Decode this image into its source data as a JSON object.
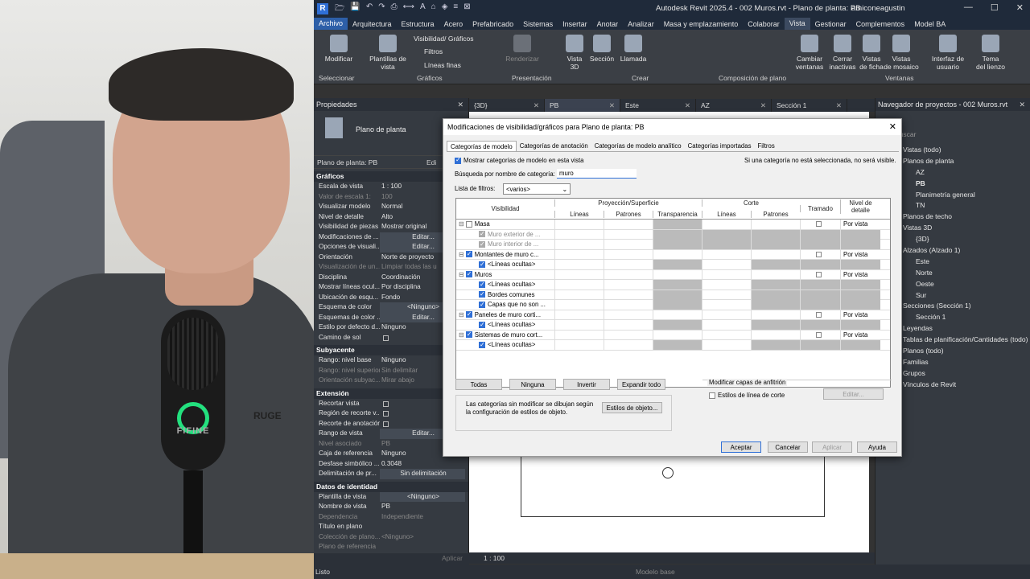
{
  "app": {
    "title": "Autodesk Revit 2025.4 - 002 Muros.rvt - Plano de planta: PB",
    "user": "amiconeagustin",
    "logo_letter": "R"
  },
  "ribbon_tabs": [
    "Archivo",
    "Arquitectura",
    "Estructura",
    "Acero",
    "Prefabricado",
    "Sistemas",
    "Insertar",
    "Anotar",
    "Analizar",
    "Masa y emplazamiento",
    "Colaborar",
    "Vista",
    "Gestionar",
    "Complementos",
    "Model BA"
  ],
  "ribbon": {
    "modify": "Modificar",
    "select": "Seleccionar",
    "plantillas": "Plantillas de\nvista",
    "vis_graf": "Visibilidad/ Gráficos",
    "filtros": "Filtros",
    "lineas_finas": "Líneas finas",
    "graficos": "Gráficos",
    "renderizar": "Renderizar",
    "presentacion": "Presentación",
    "vista3d": "Vista\n3D",
    "seccion": "Sección",
    "llamada": "Llamada",
    "crear": "Crear",
    "comp_plano": "Composición de plano",
    "cambiar": "Cambiar\nventanas",
    "cerrar": "Cerrar\ninactivas",
    "ficha": "Vistas\nde ficha",
    "mosaico": "Vistas\nde mosaico",
    "interfaz": "Interfaz de\nusuario",
    "tema": "Tema\ndel lienzo",
    "ventanas": "Ventanas"
  },
  "properties": {
    "header": "Propiedades",
    "type_name": "Plano de planta",
    "type_selector": "Plano de planta: PB",
    "edit_type": "Edi",
    "sections": [
      {
        "title": "Gráficos",
        "rows": [
          {
            "k": "Escala de vista",
            "v": "1 : 100"
          },
          {
            "k": "Valor de escala  1:",
            "v": "100",
            "dis": true
          },
          {
            "k": "Visualizar modelo",
            "v": "Normal"
          },
          {
            "k": "Nivel de detalle",
            "v": "Alto"
          },
          {
            "k": "Visibilidad de piezas",
            "v": "Mostrar original"
          },
          {
            "k": "Modificaciones de ...",
            "v": "Editar...",
            "btn": true
          },
          {
            "k": "Opciones de visuali...",
            "v": "Editar...",
            "btn": true
          },
          {
            "k": "Orientación",
            "v": "Norte de proyecto"
          },
          {
            "k": "Visualización de un...",
            "v": "Limpiar todas las u",
            "dis": true
          },
          {
            "k": "Disciplina",
            "v": "Coordinación"
          },
          {
            "k": "Mostrar líneas ocul...",
            "v": "Por disciplina"
          },
          {
            "k": "Ubicación de esqu...",
            "v": "Fondo"
          },
          {
            "k": "Esquema de color",
            "v": "<Ninguno>",
            "btn": true
          },
          {
            "k": "Esquemas de color ...",
            "v": "Editar...",
            "btn": true
          },
          {
            "k": "Estilo por defecto d...",
            "v": "Ninguno"
          },
          {
            "k": "Camino de sol",
            "v": "",
            "cb": true
          }
        ]
      },
      {
        "title": "Subyacente",
        "rows": [
          {
            "k": "Rango: nivel base",
            "v": "Ninguno"
          },
          {
            "k": "Rango: nivel superior",
            "v": "Sin delimitar",
            "dis": true
          },
          {
            "k": "Orientación subyac...",
            "v": "Mirar abajo",
            "dis": true
          }
        ]
      },
      {
        "title": "Extensión",
        "rows": [
          {
            "k": "Recortar vista",
            "v": "",
            "cb": true
          },
          {
            "k": "Región de recorte v...",
            "v": "",
            "cb": true
          },
          {
            "k": "Recorte de anotación",
            "v": "",
            "cb": true
          },
          {
            "k": "Rango de vista",
            "v": "Editar...",
            "btn": true
          },
          {
            "k": "Nivel asociado",
            "v": "PB",
            "dis": true
          },
          {
            "k": "Caja de referencia",
            "v": "Ninguno"
          },
          {
            "k": "Desfase simbólico ...",
            "v": "0.3048"
          },
          {
            "k": "Delimitación de pr...",
            "v": "Sin delimitación",
            "btn": true
          }
        ]
      },
      {
        "title": "Datos de identidad",
        "rows": [
          {
            "k": "Plantilla de vista",
            "v": "<Ninguno>",
            "btn": true
          },
          {
            "k": "Nombre de vista",
            "v": "PB"
          },
          {
            "k": "Dependencia",
            "v": "Independiente",
            "dis": true
          },
          {
            "k": "Título en plano",
            "v": ""
          },
          {
            "k": "Colección de plano...",
            "v": "<Ninguno>",
            "dis": true
          },
          {
            "k": "Plano de referencia",
            "v": "",
            "dis": true
          },
          {
            "k": "Detalle de referencia",
            "v": "",
            "dis": true
          }
        ]
      }
    ],
    "apply": "Aplicar"
  },
  "view_tabs": [
    "{3D}",
    "PB",
    "Este",
    "AZ",
    "Sección 1"
  ],
  "view_scale": "1 : 100",
  "status": {
    "ready": "Listo",
    "model": "Modelo base",
    "sel": ":0"
  },
  "browser": {
    "header": "Navegador de proyectos - 002 Muros.rvt",
    "search": "Buscar",
    "items": [
      {
        "t": "Vistas (todo)",
        "l": 1
      },
      {
        "t": "Planos de planta",
        "l": 1
      },
      {
        "t": "AZ",
        "l": 2
      },
      {
        "t": "PB",
        "l": 2,
        "b": true
      },
      {
        "t": "Planimetría general",
        "l": 2
      },
      {
        "t": "TN",
        "l": 2
      },
      {
        "t": "Planos de techo",
        "l": 1
      },
      {
        "t": "Vistas 3D",
        "l": 1
      },
      {
        "t": "{3D}",
        "l": 2
      },
      {
        "t": "Alzados (Alzado 1)",
        "l": 1
      },
      {
        "t": "Este",
        "l": 2
      },
      {
        "t": "Norte",
        "l": 2
      },
      {
        "t": "Oeste",
        "l": 2
      },
      {
        "t": "Sur",
        "l": 2
      },
      {
        "t": "Secciones (Sección 1)",
        "l": 1
      },
      {
        "t": "Sección 1",
        "l": 2
      },
      {
        "t": "Leyendas",
        "l": 1
      },
      {
        "t": "Tablas de planificación/Cantidades (todo)",
        "l": 1
      },
      {
        "t": "Planos (todo)",
        "l": 1
      },
      {
        "t": "Familias",
        "l": 1
      },
      {
        "t": "Grupos",
        "l": 1
      },
      {
        "t": "Vínculos de Revit",
        "l": 1
      }
    ]
  },
  "dialog": {
    "title": "Modificaciones de visibilidad/gráficos para Plano de planta: PB",
    "tabs": [
      "Categorías de modelo",
      "Categorías de anotación",
      "Categorías de modelo analítico",
      "Categorías importadas",
      "Filtros"
    ],
    "show_model_label": "Mostrar categorías de modelo en esta vista",
    "hint": "Si una categoría no está seleccionada, no será visible.",
    "search_label": "Búsqueda por nombre de categoría:",
    "search_value": "muro",
    "filter_label": "Lista de filtros:",
    "filter_value": "<varios>",
    "headers": {
      "visibilidad": "Visibilidad",
      "proy": "Proyección/Superficie",
      "corte": "Corte",
      "lineas": "Líneas",
      "patrones": "Patrones",
      "transparencia": "Transparencia",
      "lineas2": "Líneas",
      "patrones2": "Patrones",
      "tramado": "Tramado",
      "nivel": "Nivel de\ndetalle"
    },
    "rows": [
      {
        "name": "Masa",
        "lvl": 0,
        "chk": false,
        "exp": true,
        "tr": true,
        "pv": "Por vista"
      },
      {
        "name": "Muro exterior de ...",
        "lvl": 1,
        "chk": true,
        "dis": true
      },
      {
        "name": "Muro interior de ...",
        "lvl": 1,
        "chk": true,
        "dis": true
      },
      {
        "name": "Montantes de muro c...",
        "lvl": 0,
        "chk": true,
        "exp": true,
        "tr": true,
        "pv": "Por vista"
      },
      {
        "name": "<Líneas ocultas>",
        "lvl": 1,
        "chk": true
      },
      {
        "name": "Muros",
        "lvl": 0,
        "chk": true,
        "exp": true,
        "tr": true,
        "pv": "Por vista"
      },
      {
        "name": "<Líneas ocultas>",
        "lvl": 1,
        "chk": true
      },
      {
        "name": "Bordes comunes",
        "lvl": 1,
        "chk": true
      },
      {
        "name": "Capas que no son ...",
        "lvl": 1,
        "chk": true
      },
      {
        "name": "Paneles de muro corti...",
        "lvl": 0,
        "chk": true,
        "exp": true,
        "tr": true,
        "pv": "Por vista"
      },
      {
        "name": "<Líneas ocultas>",
        "lvl": 1,
        "chk": true
      },
      {
        "name": "Sistemas de muro cort...",
        "lvl": 0,
        "chk": true,
        "exp": true,
        "tr": true,
        "pv": "Por vista"
      },
      {
        "name": "<Líneas ocultas>",
        "lvl": 1,
        "chk": true
      }
    ],
    "btn_todas": "Todas",
    "btn_ninguna": "Ninguna",
    "btn_invertir": "Invertir",
    "btn_expandir": "Expandir todo",
    "info_text": "Las categorías sin modificar se dibujan según la configuración de estilos de objeto.",
    "btn_estilos": "Estilos de objeto...",
    "host_title": "Modificar capas de anfitrión",
    "host_cut": "Estilos de línea de corte",
    "host_edit": "Editar...",
    "ok": "Aceptar",
    "cancel": "Cancelar",
    "apply": "Aplicar",
    "help": "Ayuda"
  },
  "webcam": {
    "mic_text": "FIFINE",
    "logo": "RUGE"
  }
}
